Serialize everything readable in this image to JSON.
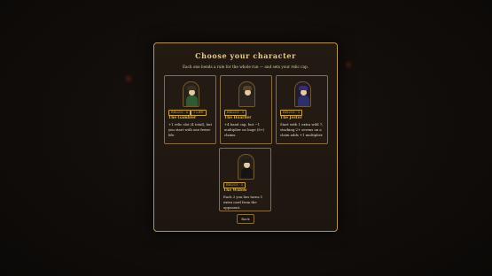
{
  "modal": {
    "title": "Choose your character",
    "subtitle": "Each one bends a rule for the whole run — and sets your relic cap."
  },
  "characters": [
    {
      "badge": "RELICS · 4",
      "badge_extra": "1 LIFE",
      "name": "The Gambler",
      "description": "+1 relic slot (4 total), but you start with one fewer life.",
      "colors": {
        "body": "#2f5a34",
        "hat": "#3c3024",
        "portrait_bg": "#2a2117"
      }
    },
    {
      "badge": "RELICS · 3",
      "name": "The Hoarder",
      "description": "+4 hand cap, but −1 multiplier on huge (8+) claims.",
      "colors": {
        "body": "#2a241c",
        "hat": "#5a3f22",
        "portrait_bg": "#2b2319"
      }
    },
    {
      "badge": "RELICS · 3",
      "name": "The Jester",
      "description": "Start with 1 extra wild 7; stacking 2+ sevens on a claim adds +1 multiplier.",
      "colors": {
        "body": "#2d2f6a",
        "hat": "#3a2a7a",
        "portrait_bg": "#221c2e"
      }
    },
    {
      "badge": "RELICS · 3",
      "name": "The Widow",
      "description": "Each 2 you lies turns 1 extra card from the opponent.",
      "colors": {
        "body": "#141414",
        "hat": "#1f1f1f",
        "portrait_bg": "#2a2117"
      }
    }
  ],
  "buttons": {
    "back_label": "Back"
  },
  "theme": {
    "border_gold": "#b9945a",
    "title_gold": "#e8c989",
    "name_gold": "#e3b24e"
  }
}
